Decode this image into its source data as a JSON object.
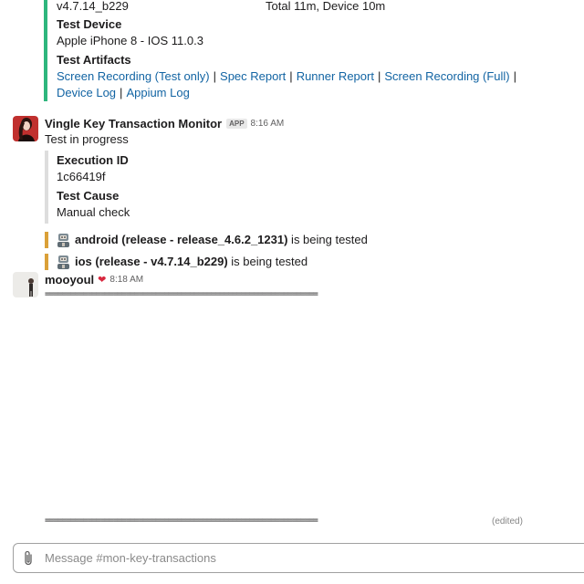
{
  "attachment_top": {
    "version": "v4.7.14_b229",
    "total": "Total 11m, Device 10m",
    "device_label": "Test Device",
    "device_value": "Apple iPhone 8 - IOS 11.0.3",
    "artifacts_label": "Test Artifacts",
    "links": [
      "Screen Recording (Test only)",
      "Spec Report",
      "Runner Report",
      "Screen Recording (Full)"
    ],
    "separator": "|",
    "links2": [
      "Device Log",
      "Appium Log"
    ],
    "accent_color": "#2eb67d"
  },
  "bot_message": {
    "sender": "Vingle Key Transaction Monitor",
    "badge": "APP",
    "time": "8:16 AM",
    "text": "Test in progress",
    "execution_label": "Execution ID",
    "execution_value": "1c66419f",
    "cause_label": "Test Cause",
    "cause_value": "Manual check",
    "tests": [
      {
        "platform_text": "android (release - release_4.6.2_1231)",
        "suffix": " is being tested"
      },
      {
        "platform_text": "ios (release - v4.7.14_b229)",
        "suffix": " is being tested"
      }
    ],
    "test_icon": "robot-icon",
    "test_accent_color": "#daa038"
  },
  "user_message": {
    "sender": "mooyoul",
    "status_icon": "heart-icon",
    "time": "8:18 AM",
    "line1": "================================================================",
    "line2": "================================================================",
    "edited": "(edited)"
  },
  "composer": {
    "placeholder": "Message #mon-key-transactions",
    "attach_icon": "paperclip-icon"
  }
}
